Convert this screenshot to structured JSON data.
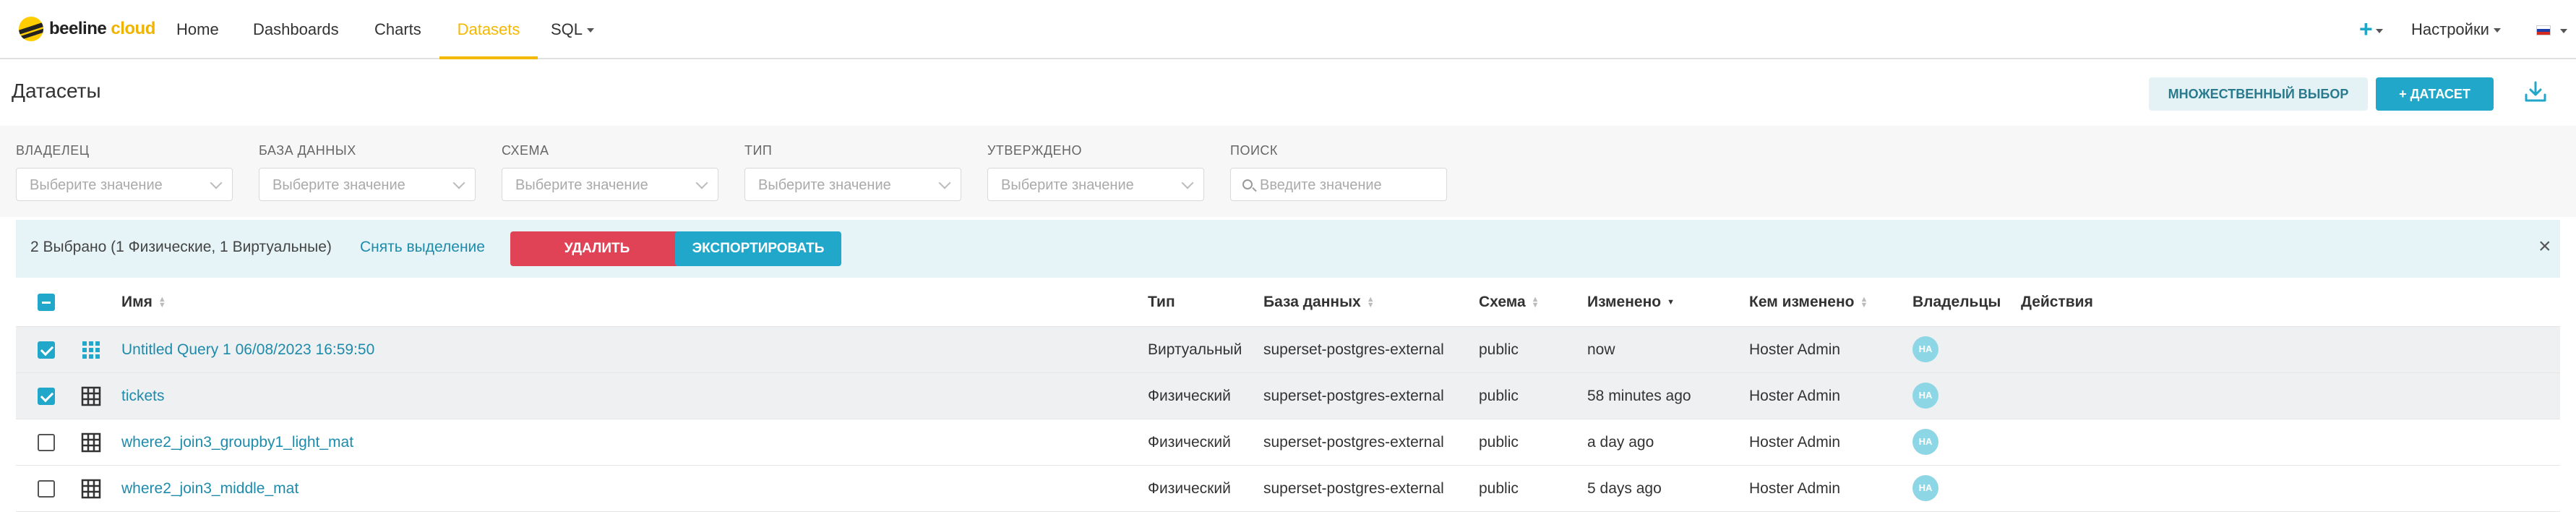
{
  "navbar": {
    "logo_brand": "beeline",
    "logo_accent": "cloud",
    "items": [
      {
        "label": "Home"
      },
      {
        "label": "Dashboards"
      },
      {
        "label": "Charts"
      },
      {
        "label": "Datasets"
      },
      {
        "label": "SQL"
      }
    ],
    "active_item": "Datasets",
    "settings_label": "Настройки",
    "accent_color": "#f5b800"
  },
  "header": {
    "title": "Датасеты",
    "multi_select_label": "МНОЖЕСТВЕННЫЙ ВЫБОР",
    "add_dataset_label": "+ ДАТАСЕТ"
  },
  "filters": {
    "owner": {
      "label": "ВЛАДЕЛЕЦ",
      "placeholder": "Выберите значение"
    },
    "database": {
      "label": "БАЗА ДАННЫХ",
      "placeholder": "Выберите значение"
    },
    "schema": {
      "label": "СХЕМА",
      "placeholder": "Выберите значение"
    },
    "type": {
      "label": "ТИП",
      "placeholder": "Выберите значение"
    },
    "certified": {
      "label": "УТВЕРЖДЕНО",
      "placeholder": "Выберите значение"
    },
    "search": {
      "label": "ПОИСК",
      "placeholder": "Введите значение"
    }
  },
  "bulk": {
    "selected_text": "2 Выбрано (1 Физические, 1 Виртуальные)",
    "deselect_label": "Снять выделение",
    "delete_label": "УДАЛИТЬ",
    "export_label": "ЭКСПОРТИРОВАТЬ"
  },
  "table": {
    "columns": {
      "name": "Имя",
      "type": "Тип",
      "database": "База данных",
      "schema": "Схема",
      "changed": "Изменено",
      "changed_by": "Кем изменено",
      "owners": "Владельцы",
      "actions": "Действия"
    },
    "rows": [
      {
        "selected": true,
        "icon": "virtual-grid-icon",
        "name": "Untitled Query 1 06/08/2023 16:59:50",
        "type": "Виртуальный",
        "database": "superset-postgres-external",
        "schema": "public",
        "changed": "now",
        "changed_by": "Hoster Admin",
        "owner": "HA"
      },
      {
        "selected": true,
        "icon": "physical-grid-icon",
        "name": "tickets",
        "type": "Физический",
        "database": "superset-postgres-external",
        "schema": "public",
        "changed": "58 minutes ago",
        "changed_by": "Hoster Admin",
        "owner": "HA"
      },
      {
        "selected": false,
        "icon": "physical-grid-icon",
        "name": "where2_join3_groupby1_light_mat",
        "type": "Физический",
        "database": "superset-postgres-external",
        "schema": "public",
        "changed": "a day ago",
        "changed_by": "Hoster Admin",
        "owner": "HA"
      },
      {
        "selected": false,
        "icon": "physical-grid-icon",
        "name": "where2_join3_middle_mat",
        "type": "Физический",
        "database": "superset-postgres-external",
        "schema": "public",
        "changed": "5 days ago",
        "changed_by": "Hoster Admin",
        "owner": "HA"
      }
    ]
  }
}
